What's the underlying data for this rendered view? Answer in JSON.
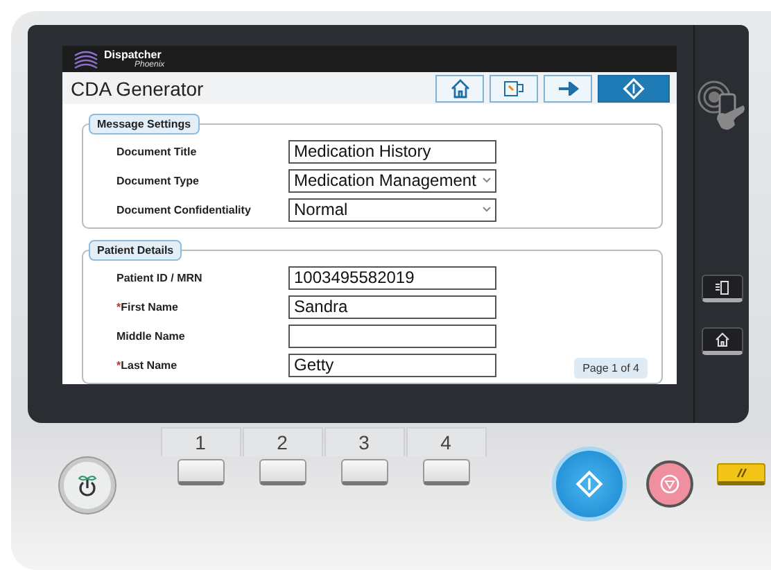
{
  "app": {
    "brand": "Dispatcher",
    "brand_sub": "Phoenix",
    "title": "CDA Generator"
  },
  "toolbar": [
    {
      "kind": "home",
      "selected": false
    },
    {
      "kind": "back",
      "selected": false
    },
    {
      "kind": "next",
      "selected": false
    },
    {
      "kind": "start",
      "selected": true
    }
  ],
  "required_marker": "*",
  "sections": [
    {
      "title": "Message Settings",
      "fields": [
        {
          "label": "Document Title",
          "kind": "text",
          "required": false,
          "value": "Medication History"
        },
        {
          "label": "Document Type",
          "kind": "select",
          "required": false,
          "value": "Medication Management"
        },
        {
          "label": "Document Confidentiality",
          "kind": "select",
          "required": false,
          "value": "Normal"
        }
      ]
    },
    {
      "title": "Patient Details",
      "fields": [
        {
          "label": "Patient ID / MRN",
          "kind": "text",
          "required": false,
          "value": "1003495582019"
        },
        {
          "label": "First Name",
          "kind": "text",
          "required": true,
          "value": "Sandra"
        },
        {
          "label": "Middle Name",
          "kind": "text",
          "required": false
        },
        {
          "label": "Last Name",
          "kind": "text",
          "required": true,
          "value": "Getty"
        }
      ]
    }
  ],
  "page_indicator": "Page 1 of 4",
  "keys": [
    "1",
    "2",
    "3",
    "4"
  ]
}
